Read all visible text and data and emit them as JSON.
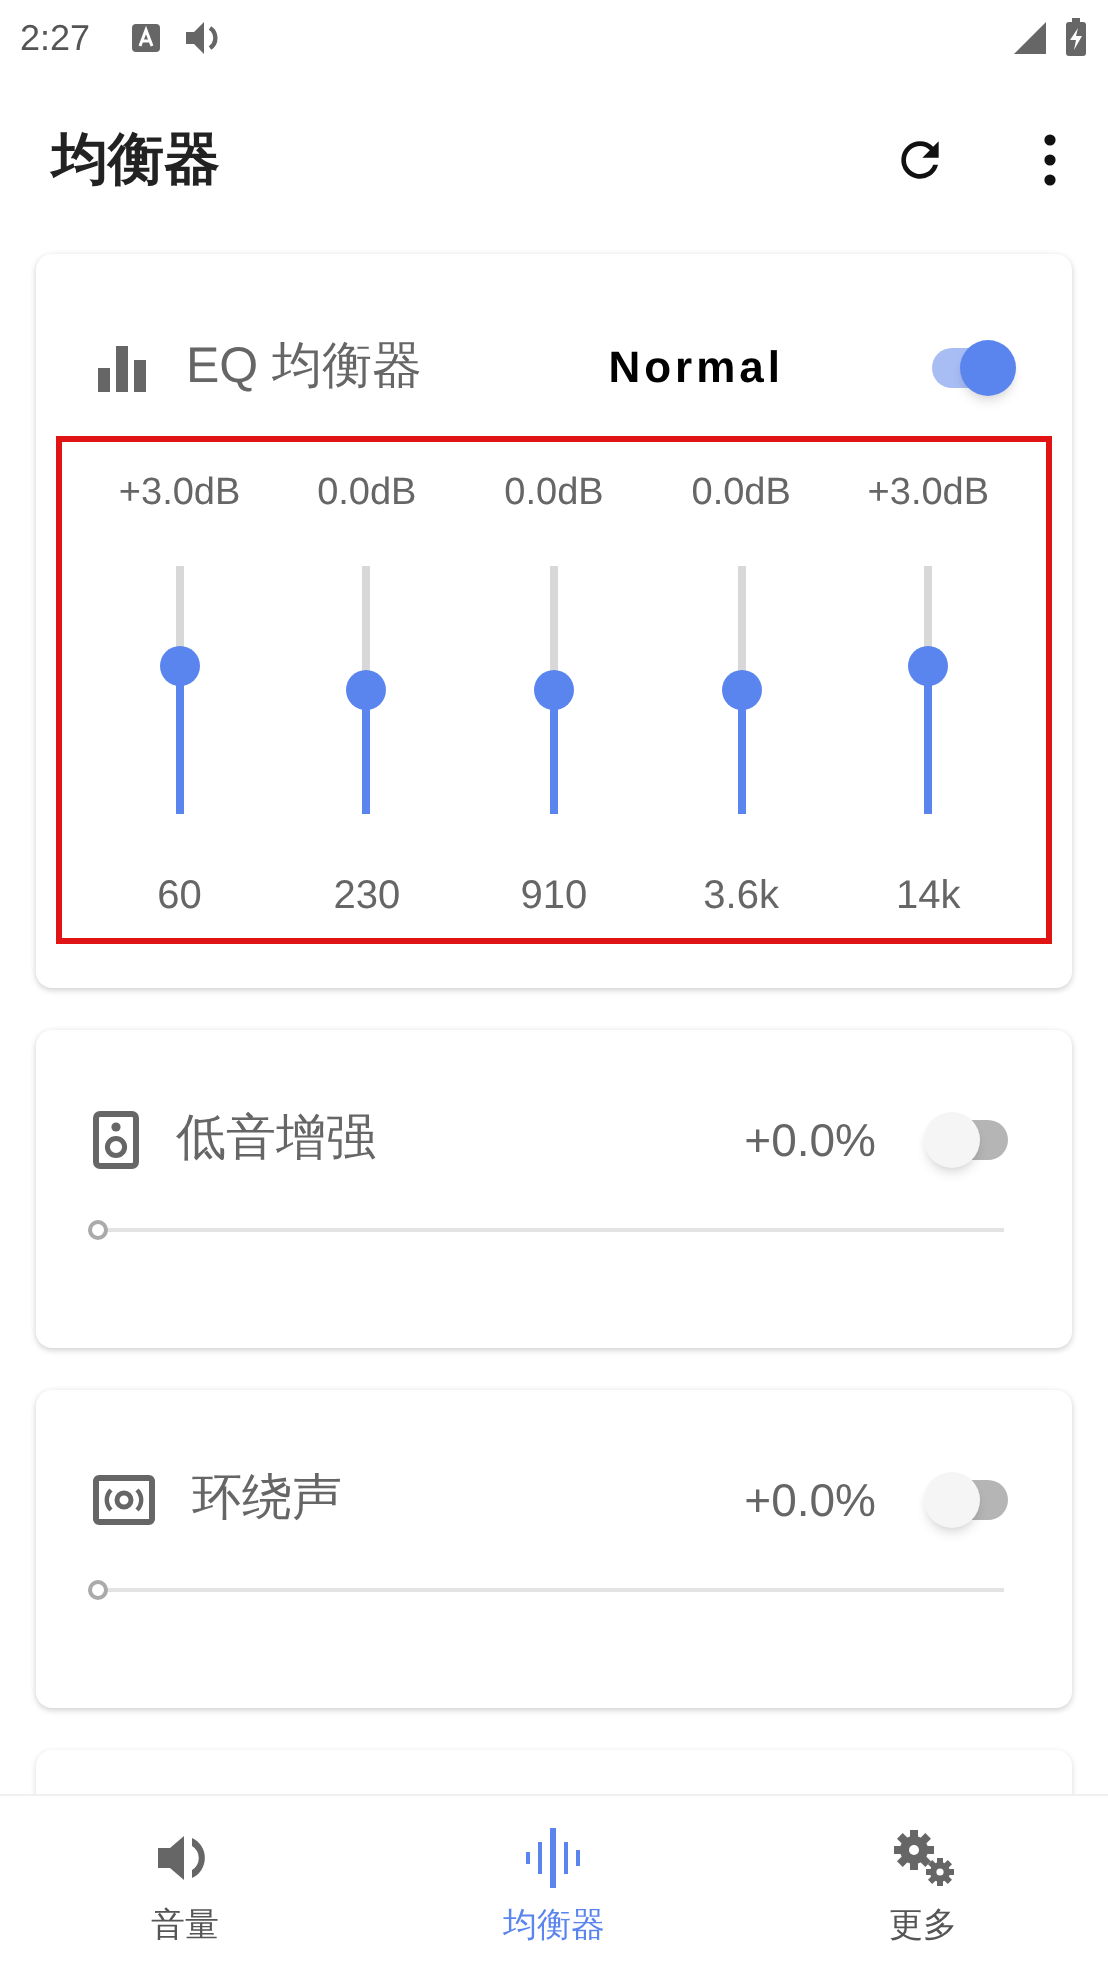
{
  "status_bar": {
    "time": "2:27"
  },
  "app_bar": {
    "title": "均衡器"
  },
  "eq_card": {
    "title": "EQ 均衡器",
    "preset": "Normal",
    "on": true,
    "bands": [
      {
        "gain": "+3.0dB",
        "level": 0.6,
        "frequency": "60"
      },
      {
        "gain": "0.0dB",
        "level": 0.5,
        "frequency": "230"
      },
      {
        "gain": "0.0dB",
        "level": 0.5,
        "frequency": "910"
      },
      {
        "gain": "0.0dB",
        "level": 0.5,
        "frequency": "3.6k"
      },
      {
        "gain": "+3.0dB",
        "level": 0.6,
        "frequency": "14k"
      }
    ]
  },
  "effects": [
    {
      "kind": "bass",
      "title": "低音增强",
      "value": "+0.0%",
      "on": false,
      "level": 0
    },
    {
      "kind": "surround",
      "title": "环绕声",
      "value": "+0.0%",
      "on": false,
      "level": 0
    }
  ],
  "bottom_nav": [
    {
      "kind": "volume",
      "label": "音量",
      "selected": false
    },
    {
      "kind": "equalizer",
      "label": "均衡器",
      "selected": true
    },
    {
      "kind": "more",
      "label": "更多",
      "selected": false
    }
  ]
}
